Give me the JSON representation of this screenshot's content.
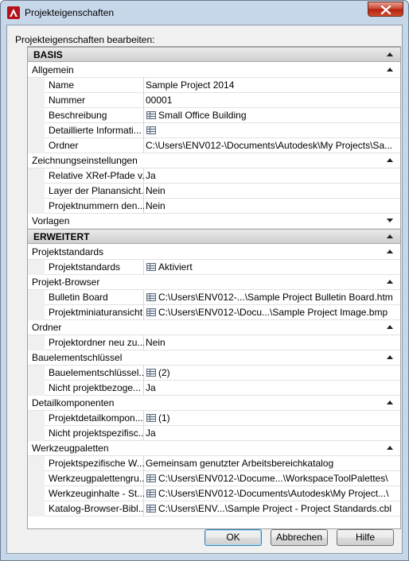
{
  "window": {
    "title": "Projekteigenschaften"
  },
  "group_label": "Projekteigenschaften bearbeiten:",
  "sections": [
    {
      "type": "cat",
      "label": "BASIS"
    },
    {
      "type": "sub",
      "label": "Allgemein",
      "arrow": "up"
    },
    {
      "type": "prop",
      "name": "Name",
      "value": "Sample Project 2014",
      "icon": false
    },
    {
      "type": "prop",
      "name": "Nummer",
      "value": "00001",
      "icon": false
    },
    {
      "type": "prop",
      "name": "Beschreibung",
      "value": "Small Office Building",
      "icon": true
    },
    {
      "type": "prop",
      "name": "Detaillierte Informati...",
      "value": "",
      "icon": true
    },
    {
      "type": "prop",
      "name": "Ordner",
      "value": "C:\\Users\\ENV012-\\Documents\\Autodesk\\My Projects\\Sa...",
      "icon": false
    },
    {
      "type": "sub",
      "label": "Zeichnungseinstellungen",
      "arrow": "up"
    },
    {
      "type": "prop",
      "name": "Relative XRef-Pfade v...",
      "value": "Ja",
      "icon": false
    },
    {
      "type": "prop",
      "name": "Layer der Planansicht...",
      "value": "Nein",
      "icon": false
    },
    {
      "type": "prop",
      "name": "Projektnummern den...",
      "value": "Nein",
      "icon": false
    },
    {
      "type": "sub",
      "label": "Vorlagen",
      "arrow": "down"
    },
    {
      "type": "cat",
      "label": "ERWEITERT"
    },
    {
      "type": "sub",
      "label": "Projektstandards",
      "arrow": "up"
    },
    {
      "type": "prop",
      "name": "Projektstandards",
      "value": "Aktiviert",
      "icon": true
    },
    {
      "type": "sub",
      "label": "Projekt-Browser",
      "arrow": "up"
    },
    {
      "type": "prop",
      "name": "Bulletin Board",
      "value": "C:\\Users\\ENV012-...\\Sample Project Bulletin Board.htm",
      "icon": true
    },
    {
      "type": "prop",
      "name": "Projektminiaturansicht",
      "value": "C:\\Users\\ENV012-\\Docu...\\Sample Project Image.bmp",
      "icon": true
    },
    {
      "type": "sub",
      "label": "Ordner",
      "arrow": "up"
    },
    {
      "type": "prop",
      "name": "Projektordner neu zu...",
      "value": "Nein",
      "icon": false
    },
    {
      "type": "sub",
      "label": "Bauelementschlüssel",
      "arrow": "up"
    },
    {
      "type": "prop",
      "name": "Bauelementschlüssel...",
      "value": "(2)",
      "icon": true
    },
    {
      "type": "prop",
      "name": "Nicht projektbezoge...",
      "value": "Ja",
      "icon": false
    },
    {
      "type": "sub",
      "label": "Detailkomponenten",
      "arrow": "up"
    },
    {
      "type": "prop",
      "name": "Projektdetailkompon...",
      "value": "(1)",
      "icon": true
    },
    {
      "type": "prop",
      "name": "Nicht projektspezifisc...",
      "value": "Ja",
      "icon": false
    },
    {
      "type": "sub",
      "label": "Werkzeugpaletten",
      "arrow": "up"
    },
    {
      "type": "prop",
      "name": "Projektspezifische W...",
      "value": "Gemeinsam genutzter Arbeitsbereichkatalog",
      "icon": false
    },
    {
      "type": "prop",
      "name": "Werkzeugpalettengru...",
      "value": "C:\\Users\\ENV012-\\Docume...\\WorkspaceToolPalettes\\",
      "icon": true
    },
    {
      "type": "prop",
      "name": "Werkzeuginhalte - St...",
      "value": "C:\\Users\\ENV012-\\Documents\\Autodesk\\My Project...\\",
      "icon": true
    },
    {
      "type": "prop",
      "name": "Katalog-Browser-Bibl...",
      "value": "C:\\Users\\ENV...\\Sample Project - Project Standards.cbl",
      "icon": true
    }
  ],
  "buttons": {
    "ok": "OK",
    "cancel": "Abbrechen",
    "help": "Hilfe"
  },
  "colors": {
    "close_button": "#c7402a",
    "category_bg": "#d6d6d6"
  }
}
